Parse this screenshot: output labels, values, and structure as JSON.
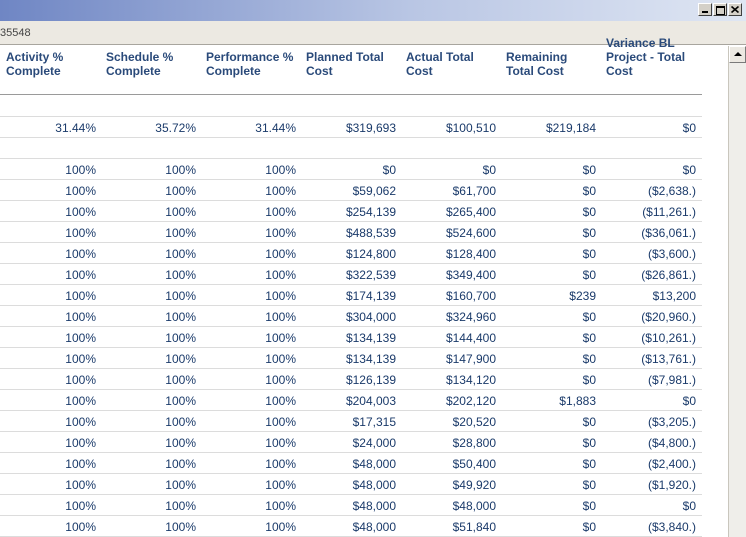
{
  "window": {
    "id_text": "35548"
  },
  "columns": [
    {
      "label_line1": "Activity %",
      "label_line2": "Complete",
      "label_line3": ""
    },
    {
      "label_line1": "Schedule %",
      "label_line2": "Complete",
      "label_line3": ""
    },
    {
      "label_line1": "Performance %",
      "label_line2": "Complete",
      "label_line3": ""
    },
    {
      "label_line1": "Planned Total",
      "label_line2": "Cost",
      "label_line3": ""
    },
    {
      "label_line1": "Actual Total",
      "label_line2": "Cost",
      "label_line3": ""
    },
    {
      "label_line1": "Remaining",
      "label_line2": "Total Cost",
      "label_line3": ""
    },
    {
      "label_line1": "Variance BL",
      "label_line2": "Project - Total",
      "label_line3": "Cost"
    }
  ],
  "summary_row": [
    "31.44%",
    "35.72%",
    "31.44%",
    "$319,693",
    "$100,510",
    "$219,184",
    "$0"
  ],
  "rows": [
    [
      "100%",
      "100%",
      "100%",
      "$0",
      "$0",
      "$0",
      "$0"
    ],
    [
      "100%",
      "100%",
      "100%",
      "$59,062",
      "$61,700",
      "$0",
      "($2,638.)"
    ],
    [
      "100%",
      "100%",
      "100%",
      "$254,139",
      "$265,400",
      "$0",
      "($11,261.)"
    ],
    [
      "100%",
      "100%",
      "100%",
      "$488,539",
      "$524,600",
      "$0",
      "($36,061.)"
    ],
    [
      "100%",
      "100%",
      "100%",
      "$124,800",
      "$128,400",
      "$0",
      "($3,600.)"
    ],
    [
      "100%",
      "100%",
      "100%",
      "$322,539",
      "$349,400",
      "$0",
      "($26,861.)"
    ],
    [
      "100%",
      "100%",
      "100%",
      "$174,139",
      "$160,700",
      "$239",
      "$13,200"
    ],
    [
      "100%",
      "100%",
      "100%",
      "$304,000",
      "$324,960",
      "$0",
      "($20,960.)"
    ],
    [
      "100%",
      "100%",
      "100%",
      "$134,139",
      "$144,400",
      "$0",
      "($10,261.)"
    ],
    [
      "100%",
      "100%",
      "100%",
      "$134,139",
      "$147,900",
      "$0",
      "($13,761.)"
    ],
    [
      "100%",
      "100%",
      "100%",
      "$126,139",
      "$134,120",
      "$0",
      "($7,981.)"
    ],
    [
      "100%",
      "100%",
      "100%",
      "$204,003",
      "$202,120",
      "$1,883",
      "$0"
    ],
    [
      "100%",
      "100%",
      "100%",
      "$17,315",
      "$20,520",
      "$0",
      "($3,205.)"
    ],
    [
      "100%",
      "100%",
      "100%",
      "$24,000",
      "$28,800",
      "$0",
      "($4,800.)"
    ],
    [
      "100%",
      "100%",
      "100%",
      "$48,000",
      "$50,400",
      "$0",
      "($2,400.)"
    ],
    [
      "100%",
      "100%",
      "100%",
      "$48,000",
      "$49,920",
      "$0",
      "($1,920.)"
    ],
    [
      "100%",
      "100%",
      "100%",
      "$48,000",
      "$48,000",
      "$0",
      "$0"
    ],
    [
      "100%",
      "100%",
      "100%",
      "$48,000",
      "$51,840",
      "$0",
      "($3,840.)"
    ]
  ]
}
